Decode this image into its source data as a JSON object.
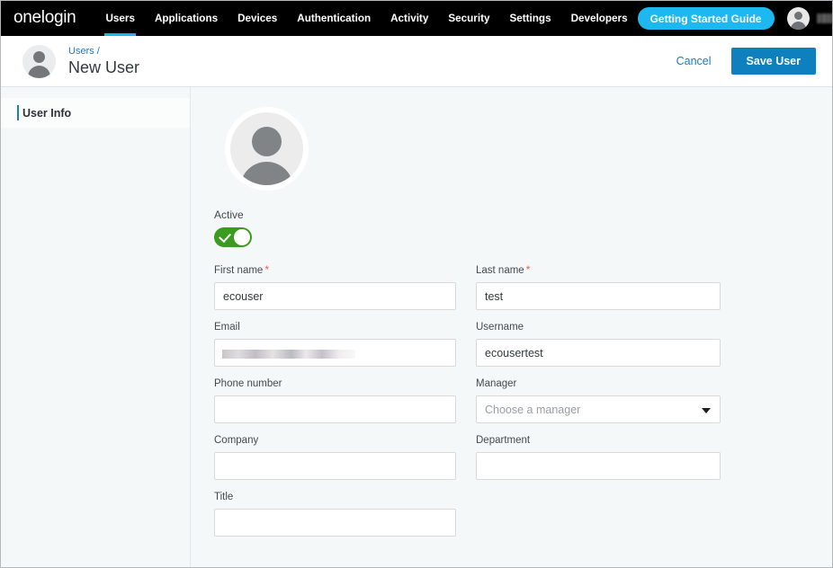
{
  "topnav": {
    "brand": "onelogin",
    "items": [
      {
        "label": "Users",
        "active": true
      },
      {
        "label": "Applications",
        "active": false
      },
      {
        "label": "Devices",
        "active": false
      },
      {
        "label": "Authentication",
        "active": false
      },
      {
        "label": "Activity",
        "active": false
      },
      {
        "label": "Security",
        "active": false
      },
      {
        "label": "Settings",
        "active": false
      },
      {
        "label": "Developers",
        "active": false
      }
    ],
    "getting_started_label": "Getting Started Guide",
    "account_name_redacted": "",
    "accent_color": "#18b6eb"
  },
  "header": {
    "breadcrumb": "Users /",
    "title": "New User",
    "cancel_label": "Cancel",
    "save_label": "Save User",
    "save_color": "#0d80bd",
    "link_color": "#1f7bbf"
  },
  "sidebar": {
    "items": [
      {
        "label": "User Info",
        "active": true
      }
    ]
  },
  "form": {
    "active": {
      "label": "Active",
      "value": "on",
      "color": "#3a9b20"
    },
    "first_name": {
      "label": "First name",
      "required": true,
      "value": "ecouser",
      "placeholder": ""
    },
    "last_name": {
      "label": "Last name",
      "required": true,
      "value": "test",
      "placeholder": ""
    },
    "email": {
      "label": "Email",
      "required": false,
      "value": "",
      "placeholder": "",
      "redacted": true
    },
    "username": {
      "label": "Username",
      "required": false,
      "value": "ecousertest",
      "placeholder": ""
    },
    "phone_number": {
      "label": "Phone number",
      "required": false,
      "value": "",
      "placeholder": ""
    },
    "manager": {
      "label": "Manager",
      "required": false,
      "value": "",
      "placeholder": "Choose a manager"
    },
    "company": {
      "label": "Company",
      "required": false,
      "value": "",
      "placeholder": ""
    },
    "department": {
      "label": "Department",
      "required": false,
      "value": "",
      "placeholder": ""
    },
    "title": {
      "label": "Title",
      "required": false,
      "value": "",
      "placeholder": ""
    },
    "required_marker": "*"
  }
}
